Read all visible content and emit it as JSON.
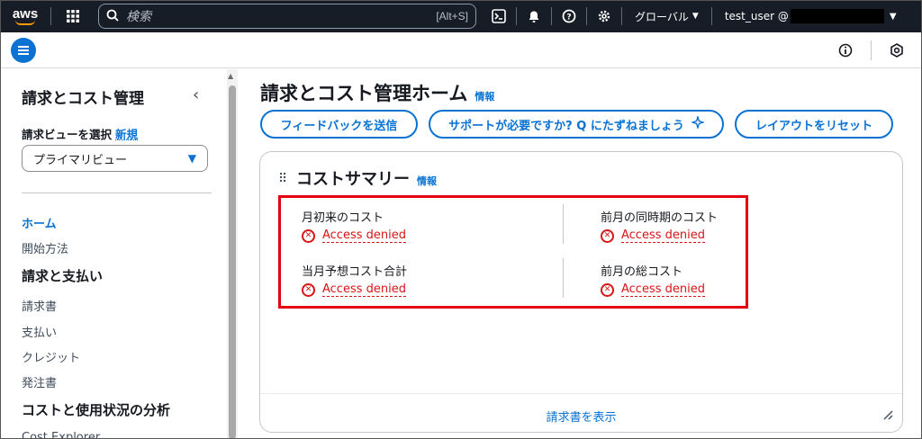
{
  "topnav": {
    "logo": "aws",
    "search_placeholder": "検索",
    "search_shortcut": "[Alt+S]",
    "region": "グローバル",
    "account": "test_user @"
  },
  "sidebar": {
    "title": "請求とコスト管理",
    "view_label": "請求ビューを選択",
    "view_new": "新規",
    "view_selected": "プライマリビュー",
    "items": [
      {
        "label": "ホーム",
        "type": "active"
      },
      {
        "label": "開始方法",
        "type": "item"
      },
      {
        "label": "請求と支払い",
        "type": "section"
      },
      {
        "label": "請求書",
        "type": "item"
      },
      {
        "label": "支払い",
        "type": "item"
      },
      {
        "label": "クレジット",
        "type": "item"
      },
      {
        "label": "発注書",
        "type": "item"
      },
      {
        "label": "コストと使用状況の分析",
        "type": "section"
      },
      {
        "label": "Cost Explorer",
        "type": "item"
      }
    ]
  },
  "main": {
    "title": "請求とコスト管理ホーム",
    "title_info": "情報",
    "buttons": {
      "feedback": "フィードバックを送信",
      "support": "サポートが必要ですか? Q にたずねましょう",
      "reset": "レイアウトをリセット"
    },
    "cost_summary": {
      "title": "コストサマリー",
      "info": "情報",
      "metrics": [
        {
          "label": "月初来のコスト",
          "value": "Access denied"
        },
        {
          "label": "前月の同時期のコスト",
          "value": "Access denied"
        },
        {
          "label": "当月予想コスト合計",
          "value": "Access denied"
        },
        {
          "label": "前月の総コスト",
          "value": "Access denied"
        }
      ],
      "footer_link": "請求書を表示"
    }
  },
  "colors": {
    "nav_bg": "#161d26",
    "accent": "#0972d3",
    "error": "#d91515",
    "highlight": "#e3000f"
  }
}
